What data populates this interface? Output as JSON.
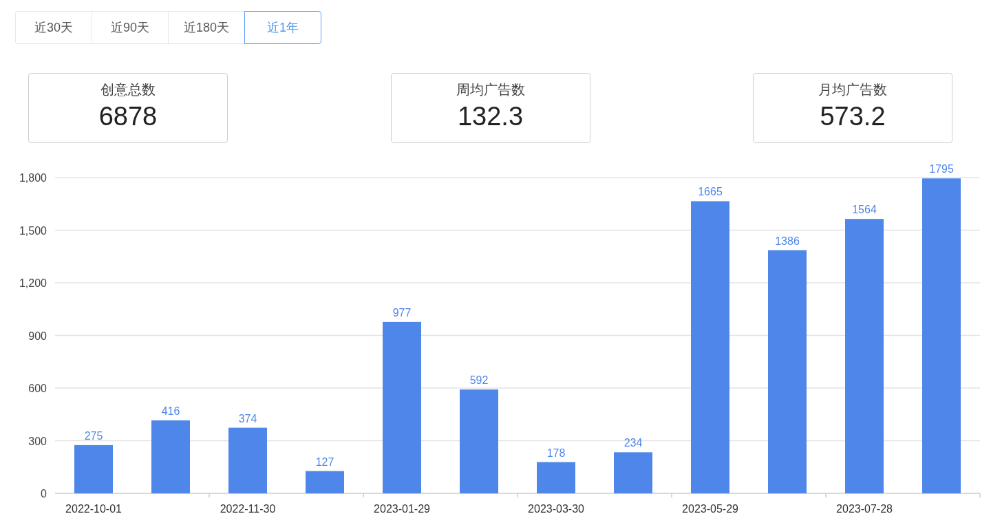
{
  "tabs": [
    {
      "label": "近30天",
      "selected": false
    },
    {
      "label": "近90天",
      "selected": false
    },
    {
      "label": "近180天",
      "selected": false
    },
    {
      "label": "近1年",
      "selected": true
    }
  ],
  "stats": [
    {
      "label": "创意总数",
      "value": "6878"
    },
    {
      "label": "周均广告数",
      "value": "132.3"
    },
    {
      "label": "月均广告数",
      "value": "573.2"
    }
  ],
  "chart_data": {
    "type": "bar",
    "categories": [
      "2022-10-01",
      null,
      "2022-11-30",
      null,
      "2023-01-29",
      null,
      "2023-03-30",
      null,
      "2023-05-29",
      null,
      "2023-07-28",
      null
    ],
    "yticks": [
      {
        "value": 0,
        "label": "0"
      },
      {
        "value": 300,
        "label": "300"
      },
      {
        "value": 600,
        "label": "600"
      },
      {
        "value": 900,
        "label": "900"
      },
      {
        "value": 1200,
        "label": "1,200"
      },
      {
        "value": 1500,
        "label": "1,500"
      },
      {
        "value": 1800,
        "label": "1,800"
      }
    ],
    "ylim": [
      0,
      1800
    ],
    "grid": true,
    "series": [
      {
        "color": "#4f86ea",
        "values": [
          275,
          416,
          374,
          127,
          977,
          592,
          178,
          234,
          1665,
          1386,
          1564,
          1795
        ]
      }
    ],
    "data_labels": true
  }
}
